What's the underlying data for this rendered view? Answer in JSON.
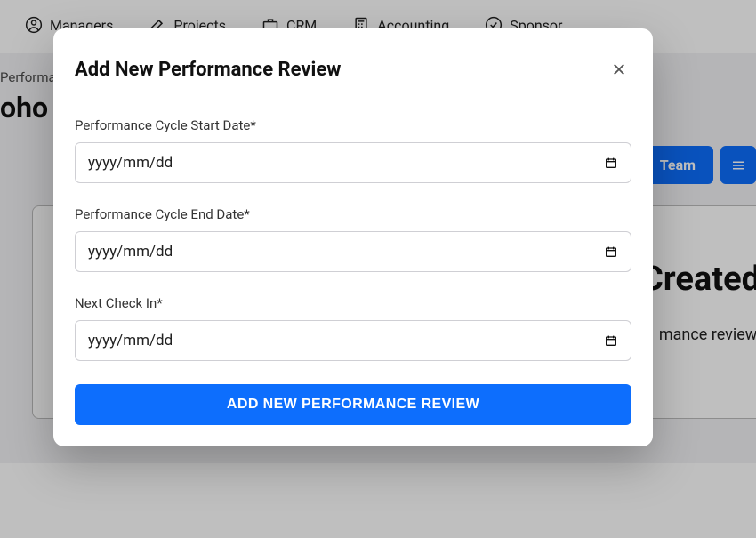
{
  "topnav": {
    "items": [
      {
        "label": "Managers"
      },
      {
        "label": "Projects"
      },
      {
        "label": "CRM"
      },
      {
        "label": "Accounting"
      },
      {
        "label": "Sponsor"
      }
    ]
  },
  "breadcrumb": "Performa",
  "page_title_fragment": "oho I",
  "tab_team": "Team",
  "empty_card": {
    "heading_fragment": "Created",
    "sub_fragment": "mance review."
  },
  "modal": {
    "title": "Add New Performance Review",
    "fields": {
      "start": {
        "label": "Performance Cycle Start Date*",
        "placeholder": "yyyy/mm/dd"
      },
      "end": {
        "label": "Performance Cycle End Date*",
        "placeholder": "yyyy/mm/dd"
      },
      "checkin": {
        "label": "Next Check In*",
        "placeholder": "yyyy/mm/dd"
      }
    },
    "submit_label": "Add New Performance Review"
  }
}
